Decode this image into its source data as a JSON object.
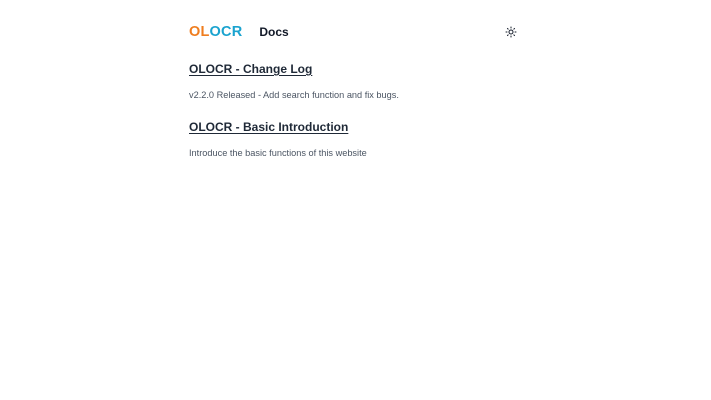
{
  "header": {
    "logo_part1": "OL",
    "logo_part2": "OCR",
    "nav_docs": "Docs",
    "theme_icon": "sun-icon"
  },
  "posts": [
    {
      "title": "OLOCR - Change Log",
      "description": "v2.2.0 Released - Add search function and fix bugs."
    },
    {
      "title": "OLOCR - Basic Introduction",
      "description": "Introduce the basic functions of this website"
    }
  ],
  "colors": {
    "logo_orange": "#ef7d1f",
    "logo_blue": "#1aa3cf",
    "text_dark": "#1f2937",
    "text_muted": "#4b5563",
    "background": "#ffffff"
  }
}
